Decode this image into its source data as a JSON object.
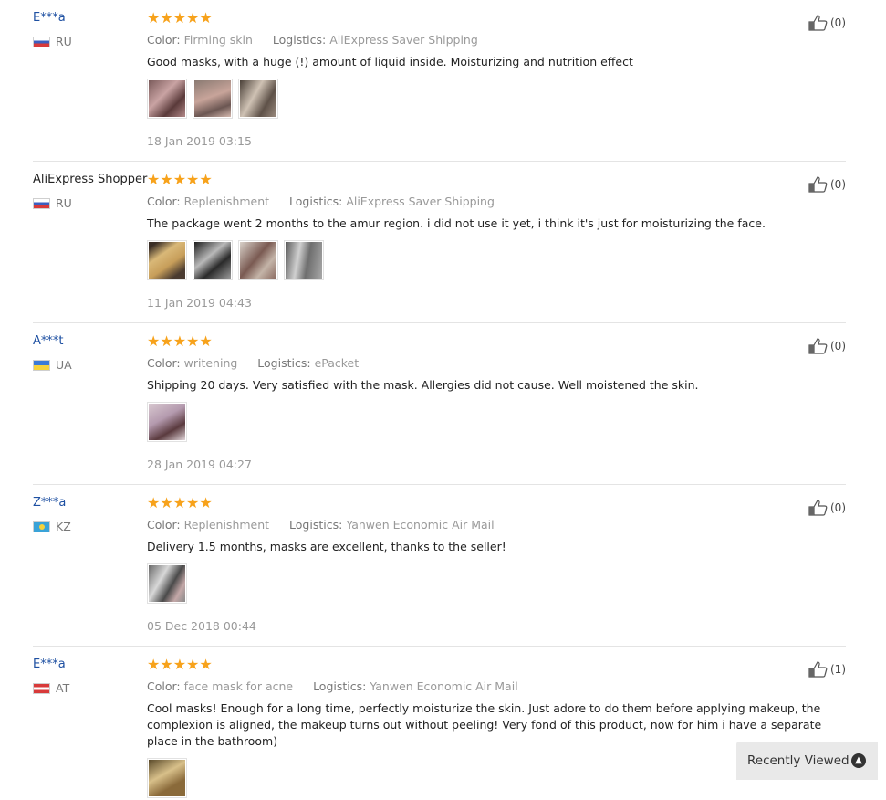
{
  "reviews": [
    {
      "user": "E***a",
      "country": "RU",
      "stars": "★★★★★",
      "color_key": "Color:",
      "color": "Firming skin",
      "logistics_key": "Logistics:",
      "logistics": "AliExpress Saver Shipping",
      "text": "Good masks, with a huge (!) amount of liquid inside. Moisturizing and nutrition effect",
      "date": "18 Jan 2019 03:15",
      "helpful": "(0)"
    },
    {
      "user": "AliExpress Shopper",
      "country": "RU",
      "stars": "★★★★★",
      "color_key": "Color:",
      "color": "Replenishment",
      "logistics_key": "Logistics:",
      "logistics": "AliExpress Saver Shipping",
      "text": "The package went 2 months to the amur region. i did not use it yet, i think it's just for moisturizing the face.",
      "date": "11 Jan 2019 04:43",
      "helpful": "(0)"
    },
    {
      "user": "A***t",
      "country": "UA",
      "stars": "★★★★★",
      "color_key": "Color:",
      "color": "writening",
      "logistics_key": "Logistics:",
      "logistics": "ePacket",
      "text": "Shipping 20 days. Very satisfied with the mask. Allergies did not cause. Well moistened the skin.",
      "date": "28 Jan 2019 04:27",
      "helpful": "(0)"
    },
    {
      "user": "Z***a",
      "country": "KZ",
      "stars": "★★★★★",
      "color_key": "Color:",
      "color": "Replenishment",
      "logistics_key": "Logistics:",
      "logistics": "Yanwen Economic Air Mail",
      "text": "Delivery 1.5 months, masks are excellent, thanks to the seller!",
      "date": "05 Dec 2018 00:44",
      "helpful": "(0)"
    },
    {
      "user": "E***a",
      "country": "AT",
      "stars": "★★★★★",
      "color_key": "Color:",
      "color": "face mask for acne",
      "logistics_key": "Logistics:",
      "logistics": "Yanwen Economic Air Mail",
      "text": "Cool masks! Enough for a long time, perfectly moisturize the skin. Just adore to do them before applying makeup, the complexion is aligned, the makeup turns out without peeling! Very fond of this product, now for him i have a separate place in the bathroom)",
      "date": "",
      "helpful": "(1)"
    }
  ],
  "recently_viewed": {
    "label": "Recently Viewed",
    "icon": "chevron-up-circle-icon"
  },
  "colors": {
    "stars": "#f7a21b",
    "user_link": "#1e50a2",
    "muted": "#999999"
  }
}
